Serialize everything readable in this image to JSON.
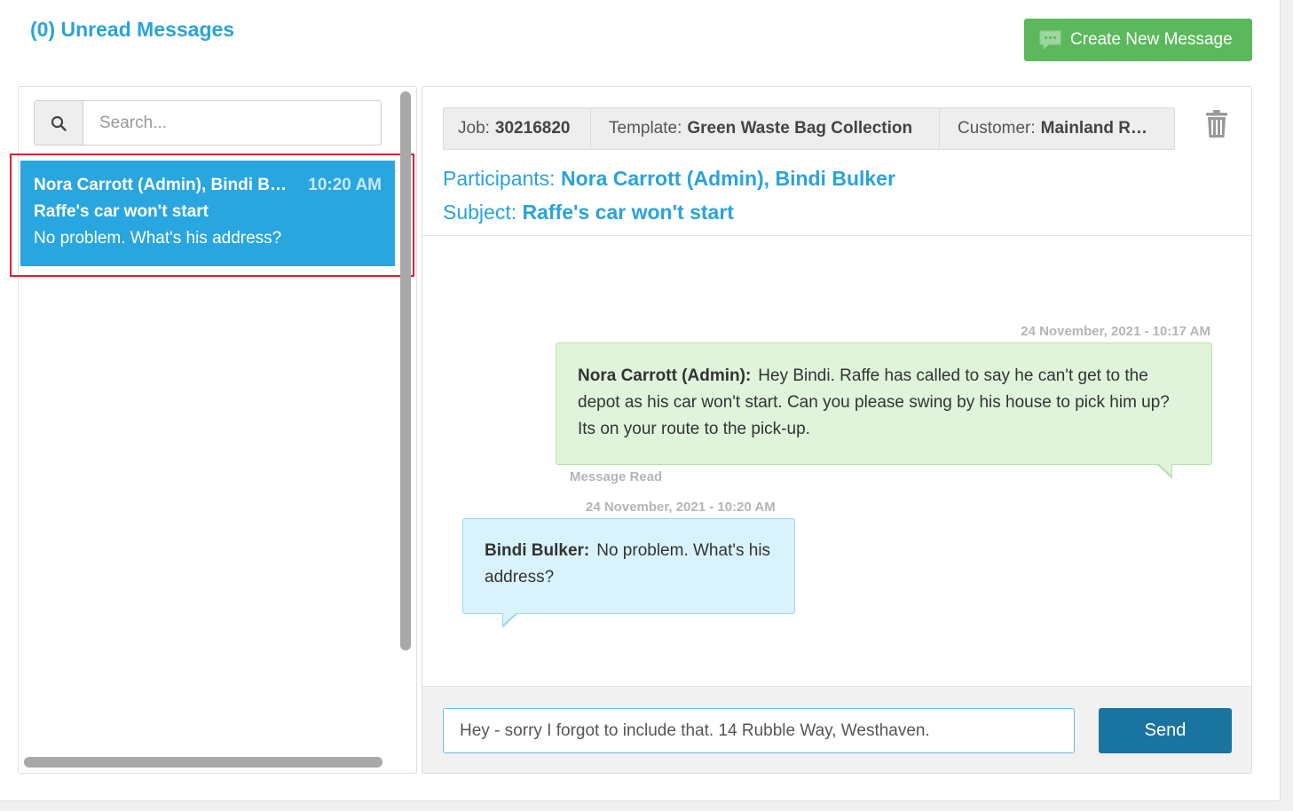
{
  "header": {
    "unread_title": "(0) Unread Messages",
    "create_button_label": "Create New Message"
  },
  "sidebar": {
    "search": {
      "placeholder": "Search...",
      "value": ""
    },
    "conversations": [
      {
        "participants": "Nora Carrott (Admin), Bindi Bulker",
        "time": "10:20 AM",
        "subject": "Raffe's car won't start",
        "preview": "No problem. What's his address?"
      }
    ]
  },
  "thread": {
    "job_label": "Job:",
    "job_value": "30216820",
    "template_label": "Template:",
    "template_value": "Green Waste Bag Collection",
    "customer_label": "Customer:",
    "customer_value": "Mainland Recycling",
    "participants_label": "Participants:",
    "participants_value": "Nora Carrott (Admin), Bindi Bulker",
    "subject_label": "Subject:",
    "subject_value": "Raffe's car won't start",
    "messages": [
      {
        "timestamp": "24 November, 2021 - 10:17 AM",
        "sender": "Nora Carrott (Admin):",
        "text": "Hey Bindi. Raffe has called to say he can't get to the depot as his car won't start. Can you please swing by his house to pick him up? Its on your route to the pick-up.",
        "status": "Message Read"
      },
      {
        "timestamp": "24 November, 2021 - 10:20 AM",
        "sender": "Bindi Bulker:",
        "text": "No problem. What's his address?"
      }
    ]
  },
  "compose": {
    "value": "Hey - sorry I forgot to include that. 14 Rubble Way, Westhaven.",
    "send_label": "Send"
  },
  "icons": {
    "search": "search-icon",
    "trash": "trash-icon",
    "chat": "chat-bubble-icon"
  },
  "colors": {
    "accent_blue": "#2aa3d9",
    "selected_item": "#29a6df",
    "create_button": "#5cb85c",
    "send_button": "#1a74a0",
    "sent_bubble": "#dff4db",
    "received_bubble": "#d8f3fc",
    "highlight_border": "#d9232d"
  }
}
